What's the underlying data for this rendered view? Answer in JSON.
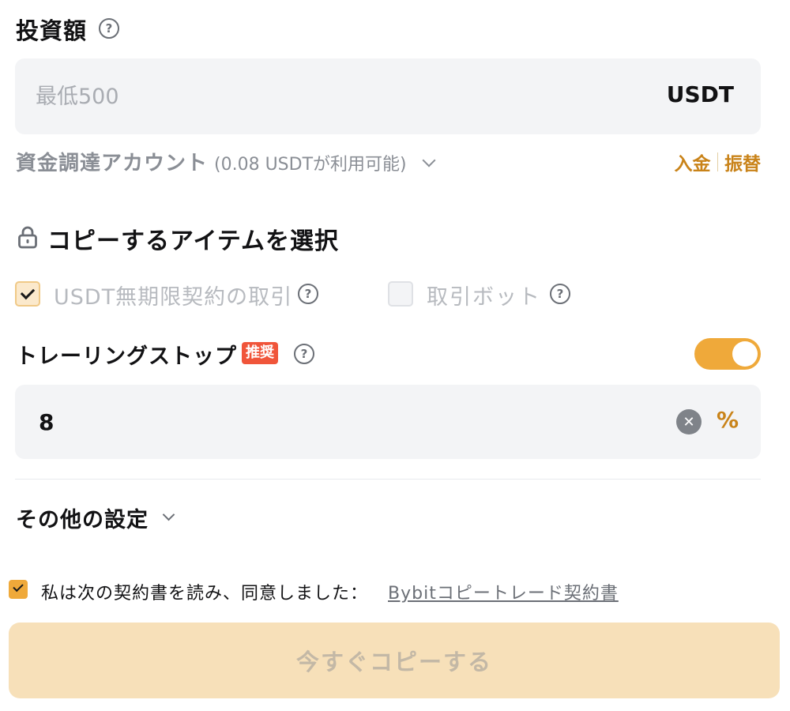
{
  "investment": {
    "title": "投資額",
    "help_icon": "help-circle-icon",
    "amount_placeholder": "最低500",
    "amount_value": "",
    "unit": "USDT"
  },
  "funding": {
    "label": "資金調達アカウント",
    "balance": "(0.08 USDTが利用可能)",
    "deposit_label": "入金",
    "transfer_label": "振替"
  },
  "copy_items": {
    "title": "コピーするアイテムを選択",
    "lock_icon": "lock-icon",
    "options": [
      {
        "label": "USDT無期限契約の取引",
        "checked": true
      },
      {
        "label": "取引ボット",
        "checked": false
      }
    ]
  },
  "trailing_stop": {
    "label": "トレーリングストップ",
    "badge": "推奨",
    "enabled": true,
    "value": "8",
    "unit": "%"
  },
  "other_settings": {
    "label": "その他の設定"
  },
  "agreement": {
    "checked": true,
    "text": "私は次の契約書を読み、同意しました：",
    "link_label": "Bybitコピートレード契約書"
  },
  "cta": {
    "label": "今すぐコピーする"
  },
  "colors": {
    "accent": "#efa93a",
    "link_accent": "#c98319",
    "badge": "#f0553a",
    "input_bg": "#f3f4f6",
    "cta_disabled_bg": "#f7e0b9"
  }
}
